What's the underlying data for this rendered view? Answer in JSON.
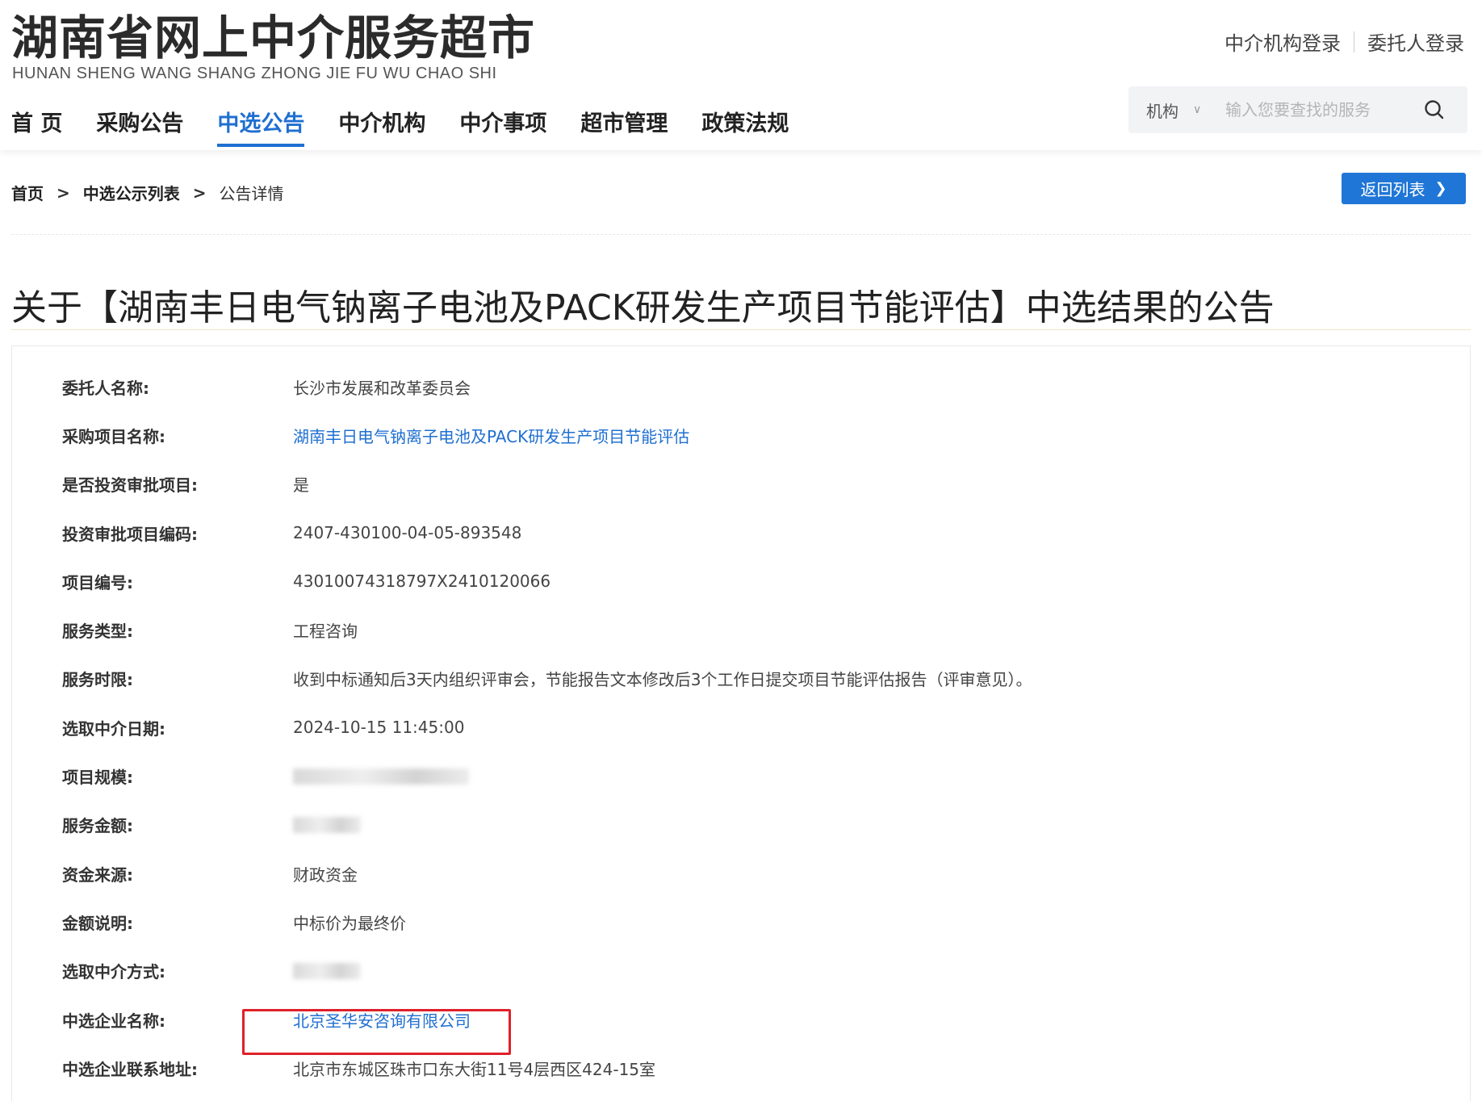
{
  "header": {
    "logo_title": "湖南省网上中介服务超市",
    "logo_subtitle": "HUNAN SHENG WANG SHANG ZHONG JIE FU WU CHAO SHI",
    "login_agency": "中介机构登录",
    "login_client": "委托人登录"
  },
  "nav": {
    "items": [
      {
        "label": "首 页"
      },
      {
        "label": "采购公告"
      },
      {
        "label": "中选公告"
      },
      {
        "label": "中介机构"
      },
      {
        "label": "中介事项"
      },
      {
        "label": "超市管理"
      },
      {
        "label": "政策法规"
      }
    ],
    "active_index": 2
  },
  "search": {
    "select_value": "机构",
    "placeholder": "输入您要查找的服务",
    "icon": "search-icon"
  },
  "breadcrumb": {
    "home": "首页",
    "list": "中选公示列表",
    "current": "公告详情",
    "separator": ">"
  },
  "back_button": {
    "label": "返回列表",
    "icon": "chevron-right-icon"
  },
  "page_title": "关于【湖南丰日电气钠离子电池及PACK研发生产项目节能评估】中选结果的公告",
  "details": [
    {
      "label": "委托人名称:",
      "value": "长沙市发展和改革委员会"
    },
    {
      "label": "采购项目名称:",
      "value": "湖南丰日电气钠离子电池及PACK研发生产项目节能评估"
    },
    {
      "label": "是否投资审批项目:",
      "value": "是"
    },
    {
      "label": "投资审批项目编码:",
      "value": "2407-430100-04-05-893548"
    },
    {
      "label": "项目编号:",
      "value": "43010074318797X2410120066"
    },
    {
      "label": "服务类型:",
      "value": "工程咨询"
    },
    {
      "label": "服务时限:",
      "value": "收到中标通知后3天内组织评审会，节能报告文本修改后3个工作日提交项目节能评估报告（评审意见）。"
    },
    {
      "label": "选取中介日期:",
      "value": "2024-10-15 11:45:00"
    },
    {
      "label": "项目规模:",
      "value": ""
    },
    {
      "label": "服务金额:",
      "value": ""
    },
    {
      "label": "资金来源:",
      "value": "财政资金"
    },
    {
      "label": "金额说明:",
      "value": "中标价为最终价"
    },
    {
      "label": "选取中介方式:",
      "value": ""
    },
    {
      "label": "中选企业名称:",
      "value": "北京圣华安咨询有限公司"
    },
    {
      "label": "中选企业联系地址:",
      "value": "北京市东城区珠市口东大街11号4层西区424-15室"
    }
  ],
  "colors": {
    "accent": "#1f6fd1",
    "button": "#1f76d6",
    "highlight": "#e0202a"
  }
}
